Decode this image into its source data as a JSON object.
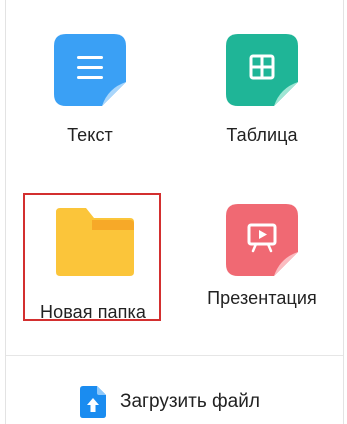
{
  "items": [
    {
      "label": "Текст",
      "icon": "text-document-icon",
      "color": "#3aa0f5"
    },
    {
      "label": "Таблица",
      "icon": "spreadsheet-icon",
      "color": "#1fb597"
    },
    {
      "label": "Новая папка",
      "icon": "folder-icon",
      "color": "#fbc53a"
    },
    {
      "label": "Презентация",
      "icon": "presentation-icon",
      "color": "#f06973"
    }
  ],
  "upload": {
    "label": "Загрузить файл",
    "icon": "upload-file-icon",
    "color": "#1a8cf0"
  },
  "selection_color": "#d32f2f"
}
